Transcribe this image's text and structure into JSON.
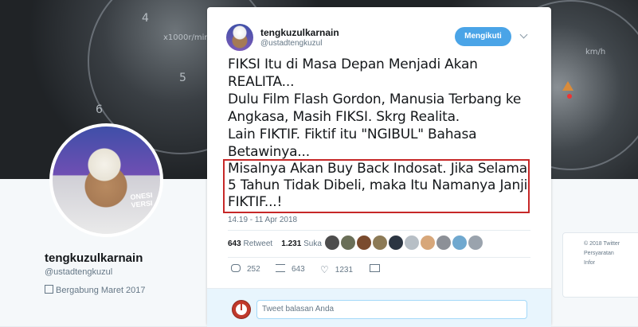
{
  "banner": {
    "gauge_left_label": "x1000r/min",
    "gauge_right_label": "km/h",
    "gauge_marks": [
      "4",
      "5",
      "6"
    ]
  },
  "profile": {
    "name": "tengkuzulkarnain",
    "handle": "@ustadtengkuzul",
    "joined": "Bergabung Maret 2017",
    "avatar_text": "ONESI VERSI"
  },
  "right_box": {
    "lines": [
      "© 2018 Twitter",
      "Persyaratan",
      "Infor"
    ]
  },
  "tweet": {
    "author_name": "tengkuzulkarnain",
    "author_handle": "@ustadtengkuzul",
    "follow_label": "Mengikuti",
    "lines": [
      "FIKSI Itu di Masa Depan Menjadi Akan",
      "REALITA...",
      "Dulu Film Flash Gordon, Manusia Terbang ke",
      "Angkasa, Masih FIKSI. Skrg Realita.",
      "Lain FIKTIF. Fiktif itu \"NGIBUL\" Bahasa",
      "Betawinya..."
    ],
    "highlighted_lines": [
      "Misalnya Akan Buy Back Indosat. Jika Selama",
      "5 Tahun Tidak Dibeli, maka Itu Namanya Janji",
      "FIKTIF...!"
    ],
    "timestamp": "14.19 - 11 Apr 2018",
    "retweet_count": "643",
    "retweet_label": "Retweet",
    "like_count": "1.231",
    "like_label": "Suka",
    "actions": {
      "reply_count": "252",
      "retweet_count": "643",
      "like_count": "1231"
    },
    "reply_placeholder": "Tweet balasan Anda"
  },
  "colors": {
    "accent": "#4aa4e7",
    "highlight_border": "#c62828"
  }
}
